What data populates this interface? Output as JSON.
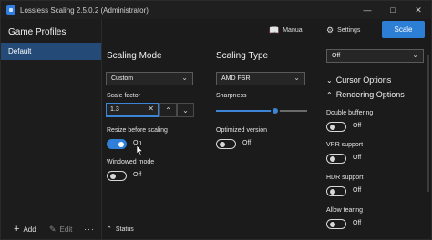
{
  "window": {
    "title": "Lossless Scaling 2.5.0.2 (Administrator)",
    "minimize_icon": "minimize-icon",
    "maximize_icon": "maximize-icon",
    "close_icon": "close-icon"
  },
  "left_panel": {
    "title": "Game Profiles",
    "profiles": [
      "Default"
    ],
    "add_label": "Add",
    "edit_label": "Edit",
    "more_label": "···"
  },
  "toolbar": {
    "manual_label": "Manual",
    "settings_label": "Settings",
    "scale_label": "Scale"
  },
  "scaling_mode": {
    "title": "Scaling Mode",
    "mode_value": "Custom",
    "scale_factor_label": "Scale factor",
    "scale_factor_value": "1.3",
    "resize_label": "Resize before scaling",
    "resize_state": "On",
    "windowed_label": "Windowed mode",
    "windowed_state": "Off"
  },
  "scaling_type": {
    "title": "Scaling Type",
    "type_value": "AMD FSR",
    "sharpness_label": "Sharpness",
    "sharpness_level": 0.65,
    "optimized_label": "Optimized version",
    "optimized_state": "Off"
  },
  "right_panel": {
    "top_select_value": "Off",
    "cursor_options": "Cursor Options",
    "rendering_options": "Rendering Options",
    "double_buffering_label": "Double buffering",
    "double_buffering_state": "Off",
    "vrr_label": "VRR support",
    "vrr_state": "Off",
    "hdr_label": "HDR support",
    "hdr_state": "Off",
    "tearing_label": "Allow tearing",
    "tearing_state": "Off"
  },
  "status": {
    "label": "Status"
  },
  "colors": {
    "accent": "#2f7fd8",
    "selected_profile": "#244a78",
    "background": "#1b1b1b"
  }
}
